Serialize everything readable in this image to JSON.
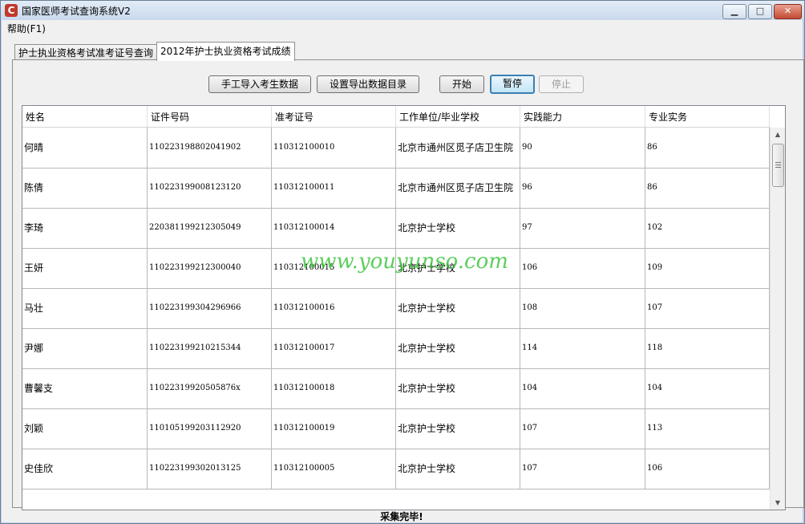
{
  "window": {
    "title": "国家医师考试查询系统V2",
    "app_icon_glyph": "C",
    "minimize_glyph": "▁",
    "maximize_glyph": "□",
    "close_glyph": "✕"
  },
  "menu": {
    "help": "帮助(F1)"
  },
  "tabs": [
    {
      "label": "护士执业资格考试准考证号查询",
      "active": false
    },
    {
      "label": "2012年护士执业资格考试成绩",
      "active": true
    }
  ],
  "toolbar": {
    "import_label": "手工导入考生数据",
    "export_label": "设置导出数据目录",
    "start_label": "开始",
    "pause_label": "暂停",
    "stop_label": "停止"
  },
  "grid": {
    "columns": [
      "姓名",
      "证件号码",
      "准考证号",
      "工作单位/毕业学校",
      "实践能力",
      "专业实务"
    ],
    "rows": [
      [
        "何晴",
        "110223198802041902",
        "110312100010",
        "北京市通州区觅子店卫生院",
        "90",
        "86"
      ],
      [
        "陈倩",
        "110223199008123120",
        "110312100011",
        "北京市通州区觅子店卫生院",
        "96",
        "86"
      ],
      [
        "李琦",
        "220381199212305049",
        "110312100014",
        "北京护士学校",
        "97",
        "102"
      ],
      [
        "王妍",
        "110223199212300040",
        "110312100015",
        "北京护士学校",
        "106",
        "109"
      ],
      [
        "马壮",
        "110223199304296966",
        "110312100016",
        "北京护士学校",
        "108",
        "107"
      ],
      [
        "尹娜",
        "110223199210215344",
        "110312100017",
        "北京护士学校",
        "114",
        "118"
      ],
      [
        "曹馨支",
        "11022319920505876x",
        "110312100018",
        "北京护士学校",
        "104",
        "104"
      ],
      [
        "刘颖",
        "110105199203112920",
        "110312100019",
        "北京护士学校",
        "107",
        "113"
      ],
      [
        "史佳欣",
        "110223199302013125",
        "110312100005",
        "北京护士学校",
        "107",
        "106"
      ]
    ]
  },
  "scrollbar": {
    "up_glyph": "▲",
    "down_glyph": "▼"
  },
  "watermark": "www.youyunso.com",
  "status": "采集完毕!"
}
